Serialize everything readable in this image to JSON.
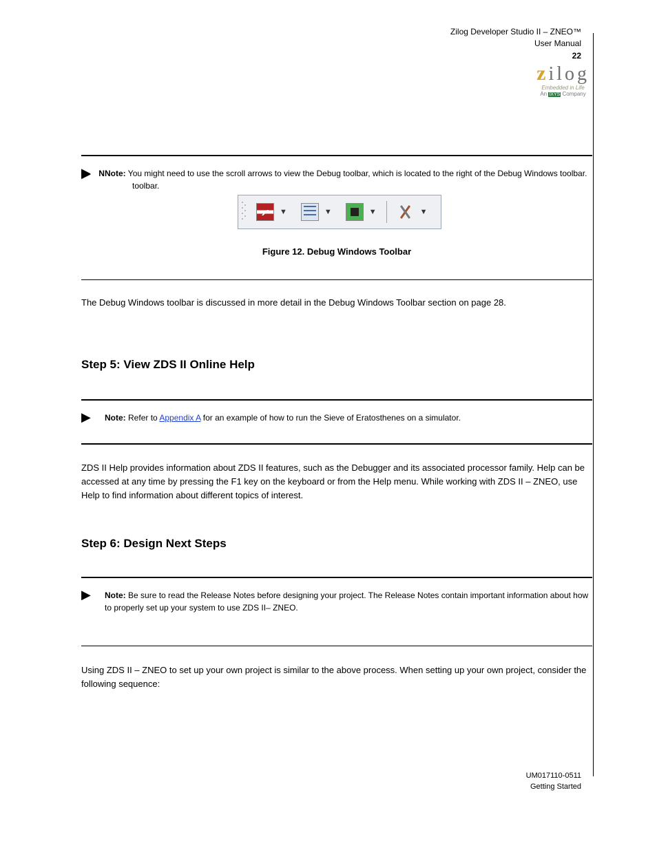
{
  "header": {
    "doc_title_line1": "Zilog Developer Studio II – ZNEO™",
    "doc_title_line2": "User Manual",
    "page_number": "22"
  },
  "logo": {
    "name": "zilog",
    "tagline1": "Embedded in Life",
    "tagline2_prefix": "An ",
    "tagline2_brand": "IXYS",
    "tagline2_suffix": " Company"
  },
  "note1": {
    "label": "Note:",
    "text": "You might need to use the scroll arrows to view the Debug toolbar, which is located to the right of the Debug Windows toolbar."
  },
  "figure": {
    "caption": "Figure 12. Debug Windows Toolbar"
  },
  "toolbar_icons": {
    "osc": "oscilloscope-icon",
    "list": "list-icon",
    "chip": "chip-icon",
    "tools": "tools-icon"
  },
  "para1": "The Debug Windows toolbar is discussed in more detail in the Debug Windows Toolbar section on page 28.",
  "h_step5": "Step 5: View ZDS II Online Help",
  "note2": {
    "label": "Note:",
    "text_before": "Refer to ",
    "link_text": "Appendix A",
    "text_after": " for an example of how to run the Sieve of Eratosthenes on a simulator."
  },
  "para2": "ZDS II Help provides information about ZDS II features, such as the Debugger and its associated processor family. Help can be accessed at any time by pressing the F1 key on the keyboard or from the Help menu. While working with ZDS II – ZNEO, use Help to find information about different topics of interest.",
  "h_step6": "Step 6: Design Next Steps",
  "note3": {
    "label": "Note:",
    "text": "Be sure to read the Release Notes before designing your project. The Release Notes contain important information about how to properly set up your system to use ZDS II– ZNEO."
  },
  "para3": "Using ZDS II – ZNEO to set up your own project is similar to the above process. When setting up your own project, consider the following sequence:",
  "footer": {
    "doc_code": "UM017110-0511",
    "section": "Getting Started"
  }
}
